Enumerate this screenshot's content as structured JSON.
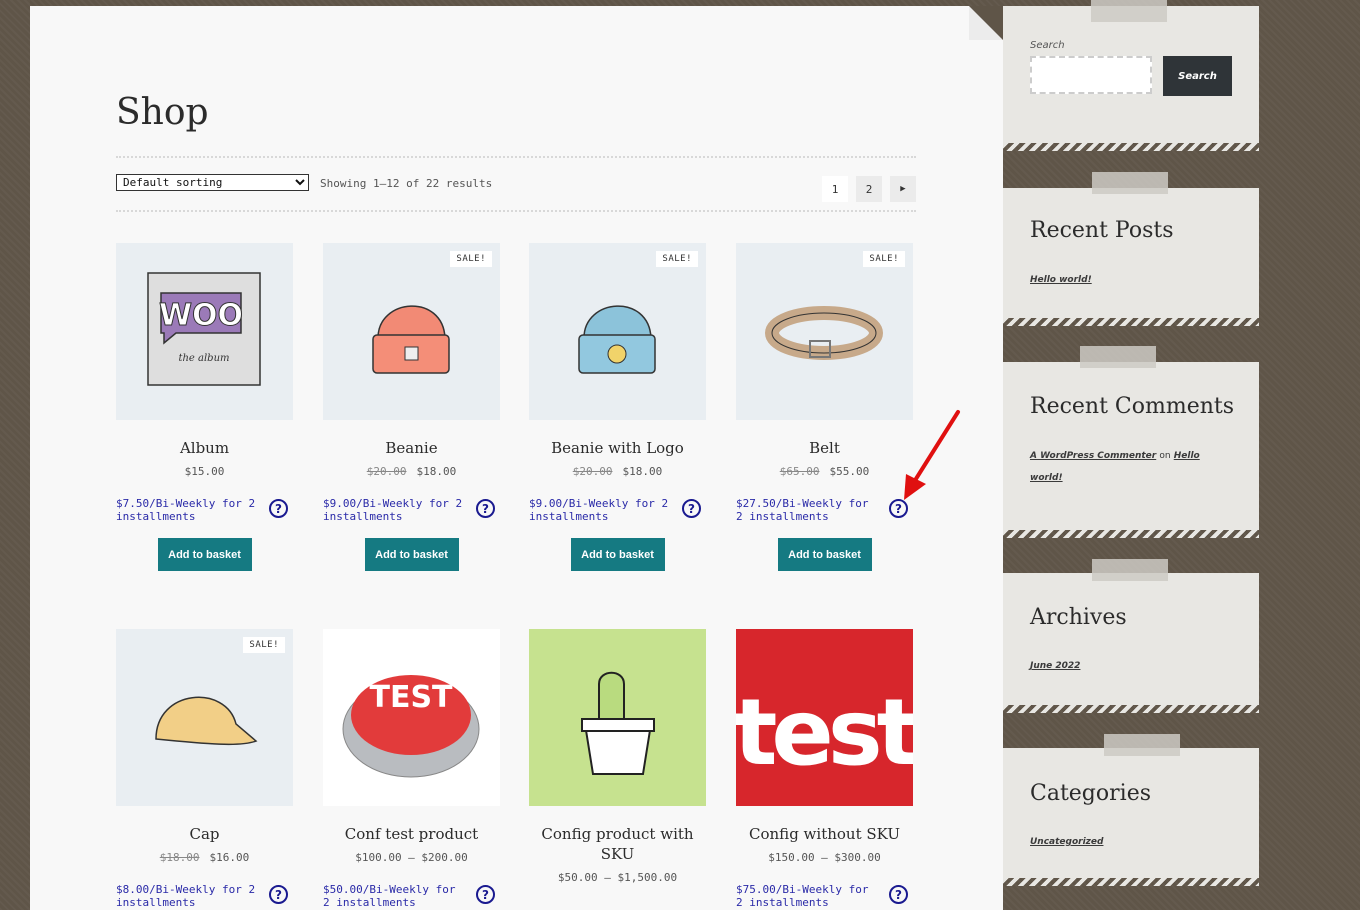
{
  "shop": {
    "title": "Shop",
    "sorting": "Default sorting",
    "result_count": "Showing 1–12 of 22 results",
    "pagination": [
      "1",
      "2",
      "→"
    ]
  },
  "products": [
    {
      "name": "Album",
      "old_price": "",
      "price": "$15.00",
      "installment": "$7.50/Bi-Weekly for 2 installments",
      "sale": "",
      "button": "Add to basket"
    },
    {
      "name": "Beanie",
      "old_price": "$20.00",
      "price": "$18.00",
      "installment": "$9.00/Bi-Weekly for 2 installments",
      "sale": "SALE!",
      "button": "Add to basket"
    },
    {
      "name": "Beanie with Logo",
      "old_price": "$20.00",
      "price": "$18.00",
      "installment": "$9.00/Bi-Weekly for 2 installments",
      "sale": "SALE!",
      "button": "Add to basket"
    },
    {
      "name": "Belt",
      "old_price": "$65.00",
      "price": "$55.00",
      "installment": "$27.50/Bi-Weekly for 2 installments",
      "sale": "SALE!",
      "button": "Add to basket"
    },
    {
      "name": "Cap",
      "old_price": "$18.00",
      "price": "$16.00",
      "installment": "$8.00/Bi-Weekly for 2 installments",
      "sale": "SALE!"
    },
    {
      "name": "Conf test product",
      "old_price": "",
      "price": "$100.00 – $200.00",
      "installment": "$50.00/Bi-Weekly for 2 installments",
      "sale": ""
    },
    {
      "name": "Config product with SKU",
      "old_price": "",
      "price": "$50.00 – $1,500.00",
      "installment": "",
      "sale": ""
    },
    {
      "name": "Config without SKU",
      "old_price": "",
      "price": "$150.00 – $300.00",
      "installment": "$75.00/Bi-Weekly for 2 installments",
      "sale": ""
    }
  ],
  "album_art": {
    "logo": "WOO",
    "caption": "the album"
  },
  "button_art": {
    "text": "TEST"
  },
  "test_art": {
    "text": "test"
  },
  "sidebar": {
    "search_label": "Search",
    "search_button": "Search",
    "recent_posts_title": "Recent Posts",
    "recent_post_1": "Hello world!",
    "recent_comments_title": "Recent Comments",
    "comment_author": "A WordPress Commenter",
    "comment_on": "on",
    "comment_post": "Hello world!",
    "archives_title": "Archives",
    "archive_1": "June 2022",
    "categories_title": "Categories",
    "category_1": "Uncategorized"
  },
  "colors": {
    "button": "#157a82",
    "installment_text": "#2a2aa8",
    "annotation_arrow": "#e01010"
  },
  "icons": [
    "help-icon",
    "arrow-right-icon",
    "annotation-arrow-icon"
  ]
}
